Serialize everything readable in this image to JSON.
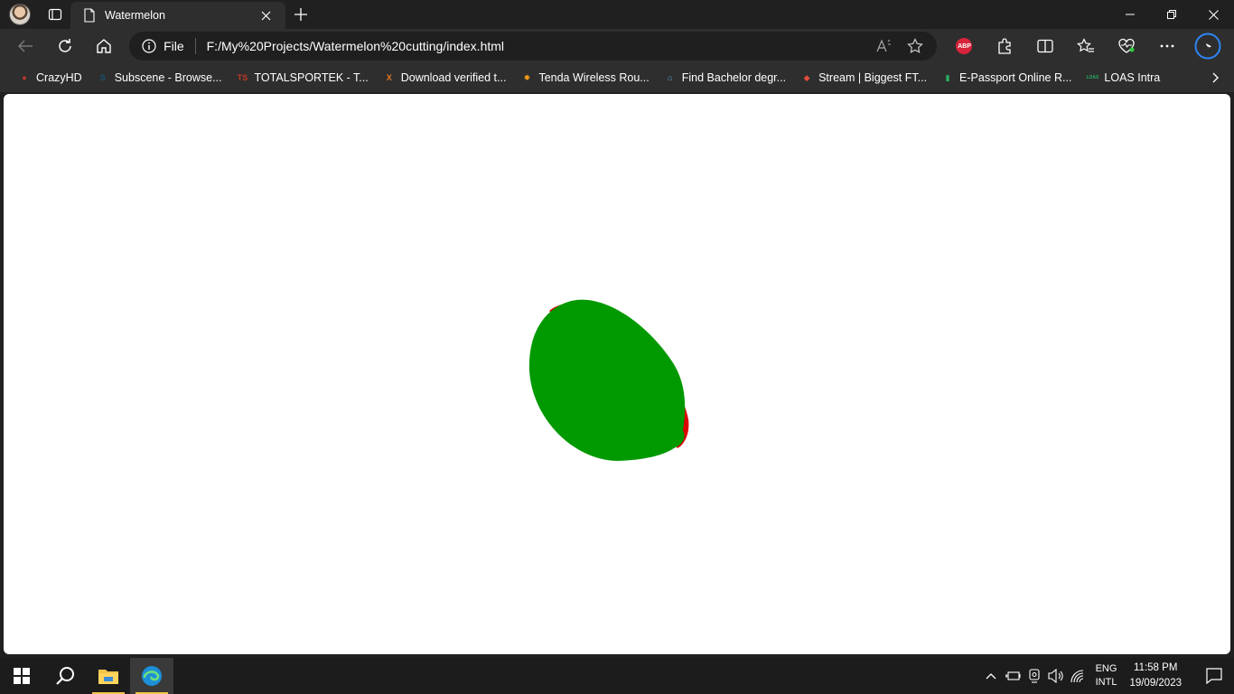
{
  "tab": {
    "title": "Watermelon"
  },
  "address": {
    "scheme_label": "File",
    "url": "F:/My%20Projects/Watermelon%20cutting/index.html"
  },
  "favorites": [
    {
      "label": "CrazyHD",
      "icon": "crazyhd-icon",
      "glyph": "●",
      "color": "#c0392b"
    },
    {
      "label": "Subscene - Browse...",
      "icon": "subscene-icon",
      "glyph": "S",
      "color": "#1a5276"
    },
    {
      "label": "TOTALSPORTEK - T...",
      "icon": "totalsportek-icon",
      "glyph": "TS",
      "color": "#c0392b"
    },
    {
      "label": "Download verified t...",
      "icon": "download-x-icon",
      "glyph": "X",
      "color": "#e67e22"
    },
    {
      "label": "Tenda Wireless Rou...",
      "icon": "tenda-icon",
      "glyph": "✹",
      "color": "#f39c12"
    },
    {
      "label": "Find Bachelor degr...",
      "icon": "university-icon",
      "glyph": "⌂",
      "color": "#5dade2"
    },
    {
      "label": "Stream | Biggest FT...",
      "icon": "stream-icon",
      "glyph": "◆",
      "color": "#e74c3c"
    },
    {
      "label": "E-Passport Online R...",
      "icon": "epassport-icon",
      "glyph": "▮",
      "color": "#27ae60"
    },
    {
      "label": "LOAS Intra",
      "icon": "loas-icon",
      "glyph": "LOAS",
      "color": "#27ae60"
    }
  ],
  "abp_label": "ABP",
  "taskbar": {
    "lang_top": "ENG",
    "lang_bottom": "INTL",
    "time": "11:58 PM",
    "date": "19/09/2023"
  },
  "colors": {
    "rind": "#009900",
    "flesh": "#dd0000",
    "page_bg": "#ffffff"
  }
}
